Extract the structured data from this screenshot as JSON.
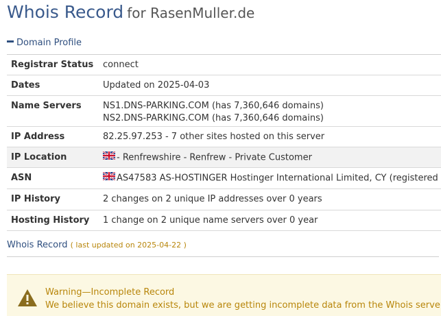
{
  "header": {
    "title": "Whois Record",
    "for_text": "for RasenMuller.de"
  },
  "domain_profile": {
    "label": "Domain Profile",
    "rows": [
      {
        "label": "Registrar Status",
        "values": [
          "connect"
        ]
      },
      {
        "label": "Dates",
        "values": [
          "Updated on 2025-04-03"
        ]
      },
      {
        "label": "Name Servers",
        "values": [
          "NS1.DNS-PARKING.COM (has 7,360,646 domains)",
          "NS2.DNS-PARKING.COM (has 7,360,646 domains)"
        ]
      },
      {
        "label": "IP Address",
        "values": [
          "82.25.97.253 - 7 other sites hosted on this server"
        ]
      },
      {
        "label": "IP Location",
        "values": [
          "- Renfrewshire - Renfrew - Private Customer"
        ],
        "flag": "uk-flag-icon"
      },
      {
        "label": "ASN",
        "values": [
          "AS47583 AS-HOSTINGER Hostinger International Limited, CY (registered"
        ],
        "flag": "uk-flag-icon"
      },
      {
        "label": "IP History",
        "values": [
          "2 changes on 2 unique IP addresses over 0 years"
        ]
      },
      {
        "label": "Hosting History",
        "values": [
          "1 change on 2 unique name servers over 0 year"
        ]
      }
    ]
  },
  "whois_record": {
    "label": "Whois Record",
    "last_updated": "( last updated on 2025-04-22 )"
  },
  "warning": {
    "icon": "warning-triangle-icon",
    "title": "Warning—Incomplete Record",
    "message": "We believe this domain exists, but we are getting incomplete data from the Whois server."
  },
  "colors": {
    "link": "#2f4f7f",
    "title": "#3a5a8c",
    "warning_text": "#b8860b",
    "warning_bg": "#fcf8e3"
  }
}
